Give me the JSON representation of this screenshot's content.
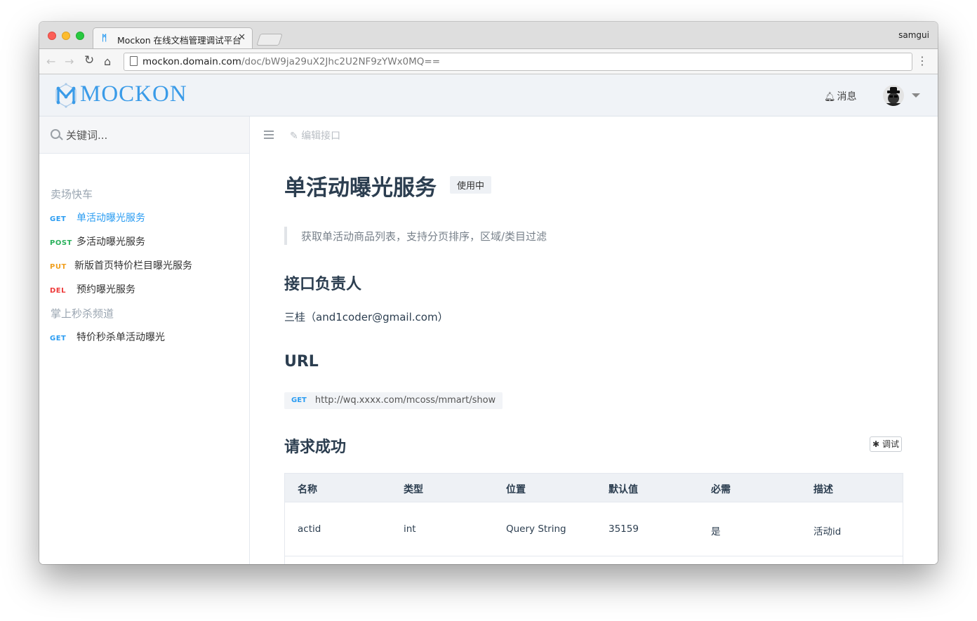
{
  "browser": {
    "tab_title": "Mockon 在线文档管理调试平台",
    "profile": "samgui",
    "url_host": "mockon.domain.com",
    "url_path": "/doc/bW9ja29uX2Jhc2U2NF9zYWx0MQ=="
  },
  "header": {
    "logo": "MOCKON",
    "messages_label": "消息"
  },
  "sidebar": {
    "search_placeholder": "关键词...",
    "groups": [
      {
        "name": "卖场快车",
        "apis": [
          {
            "method": "GET",
            "label": "单活动曝光服务"
          },
          {
            "method": "POST",
            "label": "多活动曝光服务"
          },
          {
            "method": "PUT",
            "label": "新版首页特价栏目曝光服务"
          },
          {
            "method": "DEL",
            "label": "预约曝光服务"
          }
        ]
      },
      {
        "name": "掌上秒杀频道",
        "apis": [
          {
            "method": "GET",
            "label": "特价秒杀单活动曝光"
          }
        ]
      }
    ]
  },
  "main": {
    "edit_label": "编辑接口",
    "title": "单活动曝光服务",
    "status": "使用中",
    "description": "获取单活动商品列表，支持分页排序，区域/类目过滤",
    "owner_heading": "接口负责人",
    "owner": "三桂（and1coder@gmail.com）",
    "url_heading": "URL",
    "url_method": "GET",
    "url": "http://wq.xxxx.com/mcoss/mmart/show",
    "success_heading": "请求成功",
    "debug_label": "调试",
    "table": {
      "headers": [
        "名称",
        "类型",
        "位置",
        "默认值",
        "必需",
        "描述"
      ],
      "rows": [
        [
          "actid",
          "int",
          "Query String",
          "35159",
          "是",
          "活动id"
        ]
      ]
    }
  },
  "colors": {
    "accent": "#2a9cf2",
    "post": "#2ab15c",
    "put": "#f0a020",
    "del": "#ee3a3a",
    "heading": "#2c3e50"
  },
  "icons": [
    "search-icon",
    "bell-icon",
    "edit-icon",
    "menu-icon",
    "bug-icon",
    "caret-down-icon",
    "back-icon",
    "forward-icon",
    "reload-icon",
    "home-icon"
  ]
}
